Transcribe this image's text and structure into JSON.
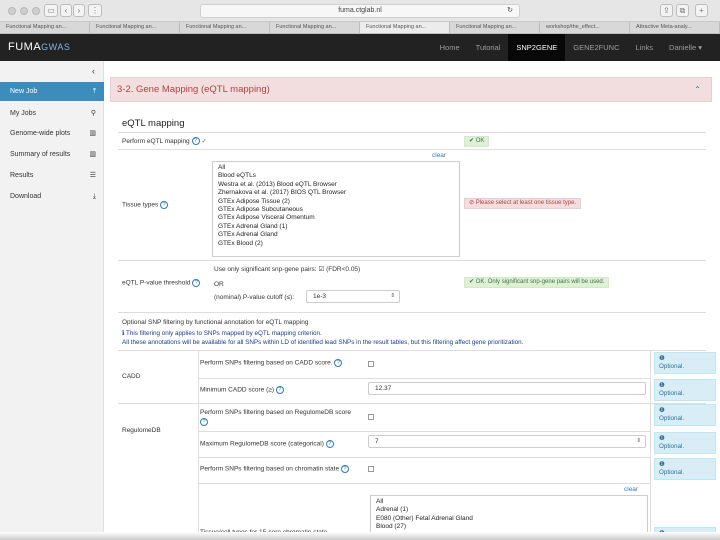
{
  "browser": {
    "url": "fuma.ctglab.nl",
    "tabs": [
      "Functional Mapping an...",
      "Functional Mapping an...",
      "Functional Mapping an...",
      "Functional Mapping an...",
      "Functional Mapping an...",
      "Functional Mapping an...",
      "workshop/the_effect...",
      "Attractive Meta-analy..."
    ]
  },
  "header": {
    "logo": "FUMA",
    "logo_sub": "GWAS",
    "nav": [
      "Home",
      "Tutorial",
      "SNP2GENE",
      "GENE2FUNC",
      "Links",
      "Danielle"
    ],
    "active_nav": "SNP2GENE"
  },
  "sidebar": {
    "items": [
      {
        "label": "New Job",
        "icon": "upload-icon"
      },
      {
        "label": "My Jobs",
        "icon": "search-icon"
      },
      {
        "label": "Genome-wide plots",
        "icon": "bar-chart-icon"
      },
      {
        "label": "Summary of results",
        "icon": "bar-chart-icon"
      },
      {
        "label": "Results",
        "icon": "list-icon"
      },
      {
        "label": "Download",
        "icon": "download-icon"
      }
    ]
  },
  "panel": {
    "title": "3-2. Gene Mapping (eQTL mapping)",
    "section": "eQTL mapping",
    "perform_label": "Perform eQTL mapping",
    "perform_ok": "✔ OK",
    "clear": "clear",
    "tissue_label": "Tissue types",
    "tissues": [
      "All",
      "Blood eQTLs",
      "Westra et al. (2013) Blood eQTL Browser",
      "Zhernakova et al. (2017) BIOS QTL Browser",
      "GTEx Adipose Tissue (2)",
      "GTEx Adipose Subcutaneous",
      "GTEx Adipose Visceral Omentum",
      "GTEx Adrenal Gland (1)",
      "GTEx Adrenal Gland",
      "GTEx Blood (2)"
    ],
    "tissue_error": "⊘ Please select at least one tissue type.",
    "pval_label": "eQTL P-value threshold",
    "sig_pairs": "Use only significant snp-gene pairs:",
    "fdr": "(FDR<0.05)",
    "or": "OR",
    "nominal": "(nominal) P-value cutoff (≤):",
    "pval_value": "1e-3",
    "pval_ok": "✔ OK. Only significant snp-gene pairs will be used.",
    "filter_title": "Optional SNP filtering by functional annotation for eQTL mapping",
    "note1": "ℹ This filtering only applies to SNPs mapped by eQTL mapping criterion.",
    "note2": "All these annotations will be available for all SNPs within LD of identified lead SNPs in the result tables, but this filtering affect gene prioritization.",
    "cadd_group": "CADD",
    "cadd_perform": "Perform SNPs filtering based on CADD score.",
    "cadd_min": "Minimum CADD score (≥)",
    "cadd_value": "12.37",
    "regdb_group": "RegulomeDB",
    "regdb_perform": "Perform SNPs filtering based on RegulomeDB score",
    "regdb_max": "Maximum RegulomeDB score (categorical)",
    "regdb_value": "7",
    "chrom_perform": "Perform SNPs filtering based on chromatin state",
    "chrom_tissue": "Tissue/cell types for 15-core chromatin state",
    "chrom_options": [
      "All",
      "Adrenal (1)",
      "E080 (Other) Fetal Adrenal Gland",
      "Blood (27)"
    ],
    "optional": "Optional."
  }
}
